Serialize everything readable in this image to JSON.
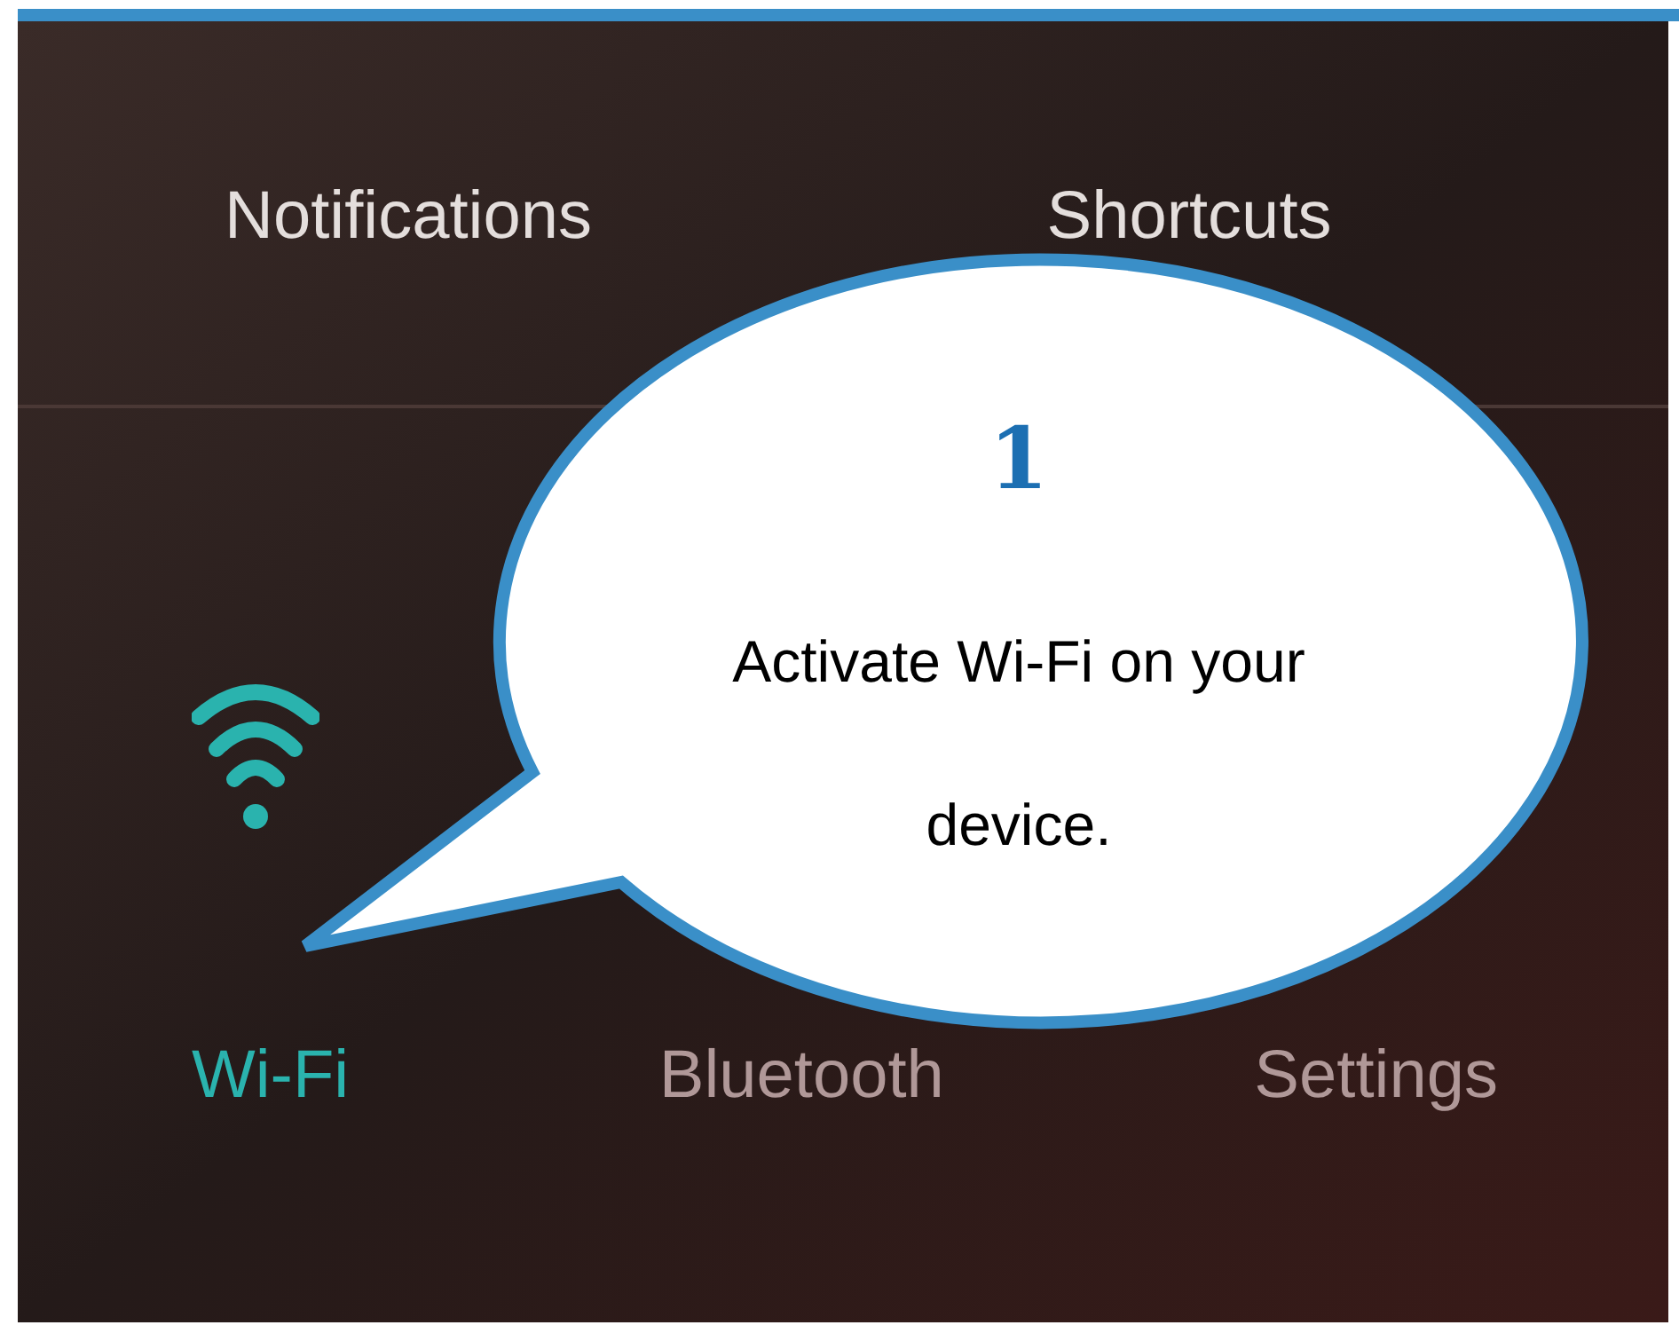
{
  "tabs": [
    {
      "label": "Notifications"
    },
    {
      "label": "Shortcuts"
    }
  ],
  "quick_settings": [
    {
      "label": "Wi-Fi",
      "on": true
    },
    {
      "label": "Bluetooth",
      "on": false
    },
    {
      "label": "Settings",
      "on": false
    }
  ],
  "callout": {
    "number": "1",
    "text": "Activate Wi-Fi on your device."
  }
}
